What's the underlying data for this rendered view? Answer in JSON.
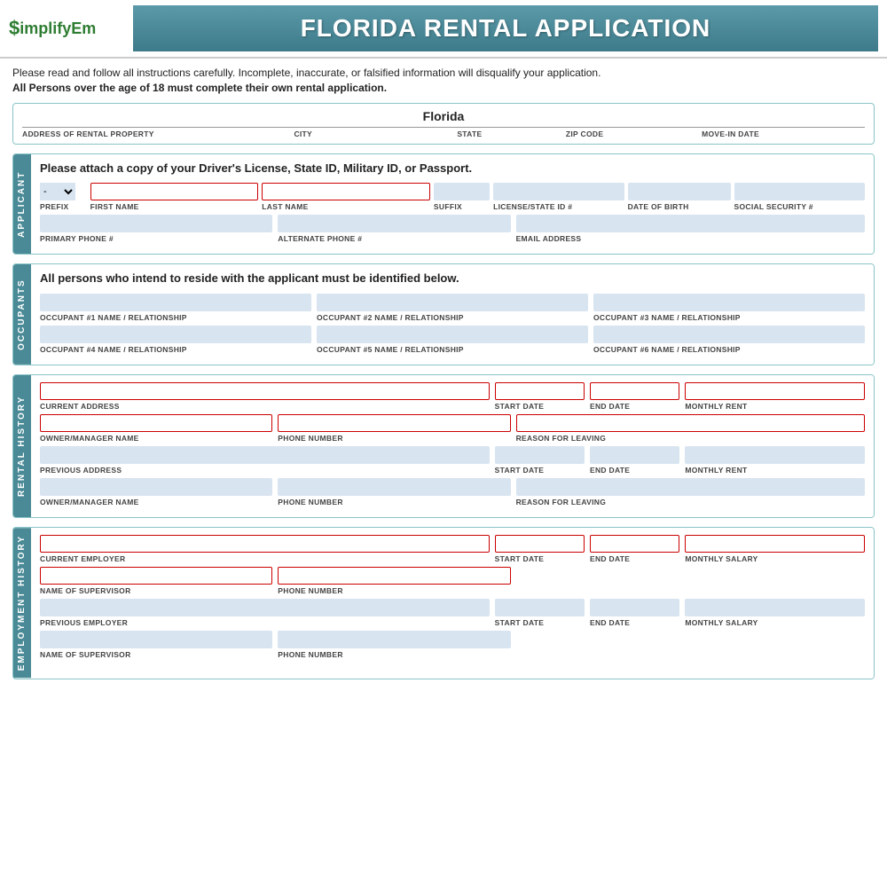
{
  "header": {
    "logo_dollar": "$",
    "logo_text": "implifyEm",
    "title": "FLORIDA RENTAL APPLICATION"
  },
  "intro": {
    "line1": "Please read and follow all instructions carefully. Incomplete, inaccurate, or falsified information will disqualify your application.",
    "line2": "All Persons over the age of 18 must complete their own rental application."
  },
  "property": {
    "state_value": "Florida",
    "address_label": "ADDRESS OF RENTAL PROPERTY",
    "city_label": "CITY",
    "state_label": "STATE",
    "zip_label": "ZIP CODE",
    "movein_label": "MOVE-IN DATE"
  },
  "applicant": {
    "side_label": "APPLICANT",
    "header_text": "Please attach a copy of your Driver's License, State ID, Military ID, or Passport.",
    "prefix_label": "PREFIX",
    "first_name_label": "FIRST NAME",
    "last_name_label": "LAST NAME",
    "suffix_label": "SUFFIX",
    "license_label": "LICENSE/STATE ID #",
    "dob_label": "DATE OF BIRTH",
    "ssn_label": "SOCIAL SECURITY #",
    "primary_phone_label": "PRIMARY PHONE #",
    "alt_phone_label": "ALTERNATE PHONE #",
    "email_label": "EMAIL ADDRESS"
  },
  "occupants": {
    "side_label": "OCCUPANTS",
    "header_text": "All persons who intend to reside with the applicant must be identified below.",
    "fields": [
      "OCCUPANT #1 NAME / RELATIONSHIP",
      "OCCUPANT #2 NAME / RELATIONSHIP",
      "OCCUPANT #3 NAME / RELATIONSHIP",
      "OCCUPANT #4 NAME / RELATIONSHIP",
      "OCCUPANT #5 NAME / RELATIONSHIP",
      "OCCUPANT #6 NAME / RELATIONSHIP"
    ]
  },
  "rental_history": {
    "side_label": "RENTAL HISTORY",
    "current_address_label": "CURRENT ADDRESS",
    "start_date_label": "START DATE",
    "end_date_label": "END DATE",
    "monthly_rent_label": "MONTHLY RENT",
    "owner_manager_label": "OWNER/MANAGER NAME",
    "phone_label": "PHONE NUMBER",
    "reason_leaving_label": "REASON FOR LEAVING",
    "previous_address_label": "PREVIOUS ADDRESS",
    "prev_start_label": "START DATE",
    "prev_end_label": "END DATE",
    "prev_rent_label": "MONTHLY RENT",
    "prev_owner_label": "OWNER/MANAGER NAME",
    "prev_phone_label": "PHONE NUMBER",
    "prev_reason_label": "REASON FOR LEAVING"
  },
  "employment_history": {
    "side_label": "EMPLOYMENT HISTORY",
    "current_employer_label": "CURRENT EMPLOYER",
    "start_date_label": "START DATE",
    "end_date_label": "END DATE",
    "monthly_salary_label": "MONTHLY SALARY",
    "supervisor_label": "NAME OF SUPERVISOR",
    "phone_label": "PHONE NUMBER",
    "prev_employer_label": "PREVIOUS EMPLOYER",
    "prev_start_label": "START DATE",
    "prev_end_label": "END DATE",
    "prev_salary_label": "MONTHLY SALARY",
    "prev_supervisor_label": "NAME OF SUPERVISOR",
    "prev_phone_label": "PHONE NUMBER"
  },
  "colors": {
    "teal": "#4a8a96",
    "light_blue_bg": "#d8e4f0",
    "red_border": "#cc0000"
  }
}
